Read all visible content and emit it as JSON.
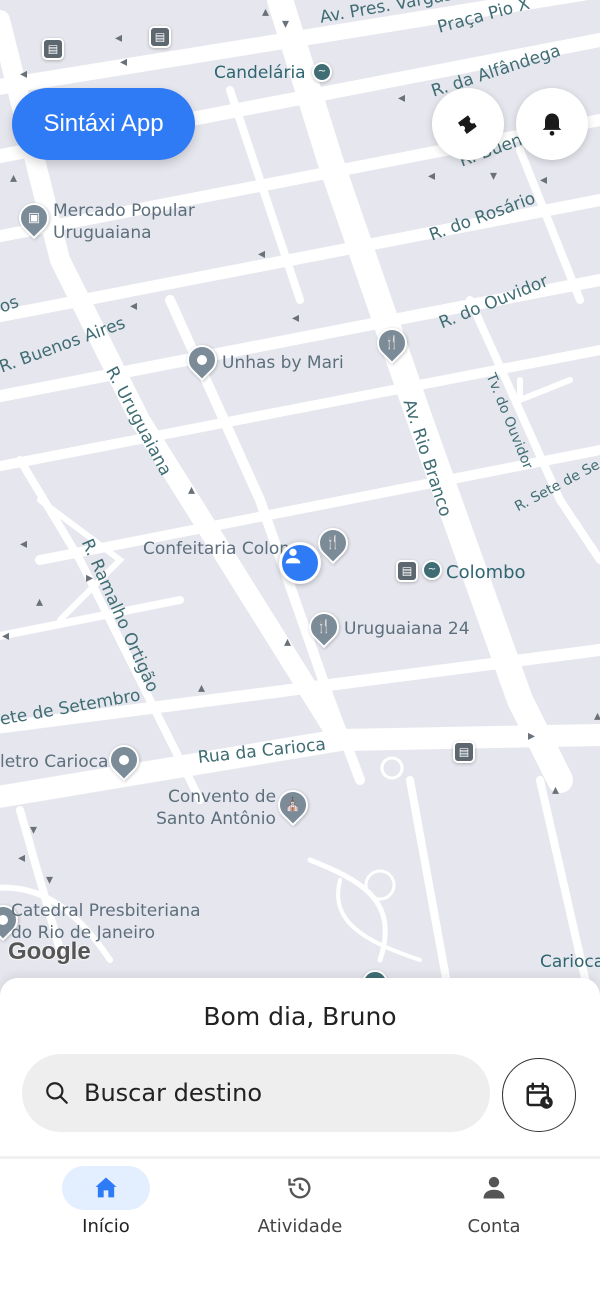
{
  "app": {
    "brand": "Sintáxi App"
  },
  "map": {
    "places": {
      "candelaria": "Candelária",
      "mercado_line1": "Mercado Popular",
      "mercado_line2": "Uruguaiana",
      "unhas": "Unhas by Mari",
      "confeitaria": "Confeitaria Colom",
      "colombo": "Colombo",
      "uruguaiana24": "Uruguaiana 24",
      "metro": "letro Carioca",
      "convento_line1": "Convento de",
      "convento_line2": "Santo Antônio",
      "catedral_line1": "Catedral Presbiteriana",
      "catedral_line2": "do Rio de Janeiro",
      "carioca": "Carioca"
    },
    "streets": {
      "pres_vargas": "Av. Pres. Vargas",
      "praca_pio": "Praça Pio X",
      "alfandega": "R. da Alfândega",
      "buenos_top": "R. Bueno",
      "rosario": "R. do Rosário",
      "ouvidor": "R. do Ouvidor",
      "buenos_aires": "R. Buenos Aires",
      "os_fragment": "os",
      "uruguaiana": "R. Uruguaiana",
      "rio_branco": "Av. Rio Branco",
      "tv_ouvidor": "Tv. do Ouvidor",
      "sete_right": "R. Sete de Se",
      "ramalho": "R. Ramalho Ortigão",
      "sete_left": "ete de Setembro",
      "carioca_rua": "Rua da Carioca"
    },
    "attribution": "Google"
  },
  "icons": {
    "ticket": "ticket-icon",
    "bell": "bell-icon",
    "search": "search-icon",
    "schedule": "calendar-clock-icon",
    "home": "home-icon",
    "history": "history-icon",
    "account": "person-icon"
  },
  "sheet": {
    "greeting": "Bom dia, Bruno",
    "search_placeholder": "Buscar destino"
  },
  "nav": {
    "items": [
      {
        "label": "Início",
        "active": true
      },
      {
        "label": "Atividade",
        "active": false
      },
      {
        "label": "Conta",
        "active": false
      }
    ]
  },
  "colors": {
    "accent": "#2f7bf5",
    "map_bg": "#e6e7ee",
    "street_label": "#3f6d73",
    "poi_label": "#5d6f7c"
  }
}
